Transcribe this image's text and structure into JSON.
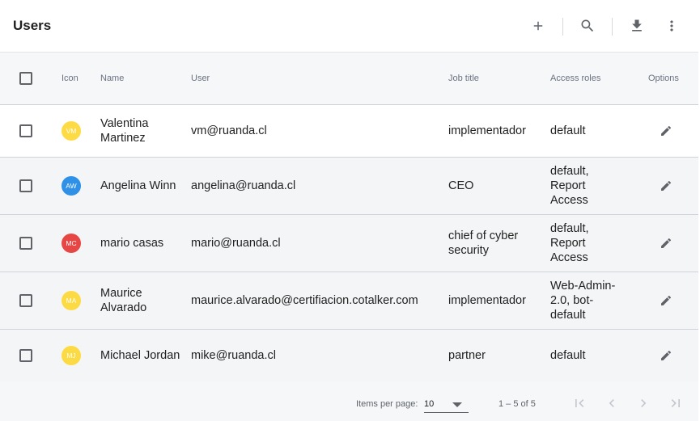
{
  "header": {
    "title": "Users",
    "add_icon": "plus-icon",
    "search_icon": "search-icon",
    "download_icon": "download-icon",
    "more_icon": "more-vert-icon"
  },
  "table": {
    "columns": [
      "",
      "Icon",
      "Name",
      "User",
      "Job title",
      "Access roles",
      "Options"
    ],
    "rows": [
      {
        "initials": "VM",
        "avatar_color": "#fdd835",
        "name": "Valentina Martinez",
        "user": "vm@ruanda.cl",
        "job_title": "implementador",
        "access_roles": "default"
      },
      {
        "initials": "AW",
        "avatar_color": "#1e88e5",
        "name": "Angelina Winn",
        "user": "angelina@ruanda.cl",
        "job_title": "CEO",
        "access_roles": "default, Report Access"
      },
      {
        "initials": "MC",
        "avatar_color": "#e53935",
        "name": "mario casas",
        "user": "mario@ruanda.cl",
        "job_title": "chief of cyber security",
        "access_roles": "default, Report Access"
      },
      {
        "initials": "MA",
        "avatar_color": "#fdd835",
        "name": "Maurice Alvarado",
        "user": "maurice.alvarado@certifiacion.cotalker.com",
        "job_title": "implementador",
        "access_roles": "Web-Admin-2.0, bot-default"
      },
      {
        "initials": "MJ",
        "avatar_color": "#fdd835",
        "name": "Michael Jordan",
        "user": "mike@ruanda.cl",
        "job_title": "partner",
        "access_roles": "default"
      }
    ]
  },
  "paginator": {
    "items_per_page_label": "Items per page:",
    "items_per_page_value": "10",
    "range_label": "1 – 5 of 5"
  },
  "colors": {
    "header_bg": "#f5f7f9",
    "row_alt_bg": "#f3f5f7",
    "icon_gray": "#5f6368"
  }
}
